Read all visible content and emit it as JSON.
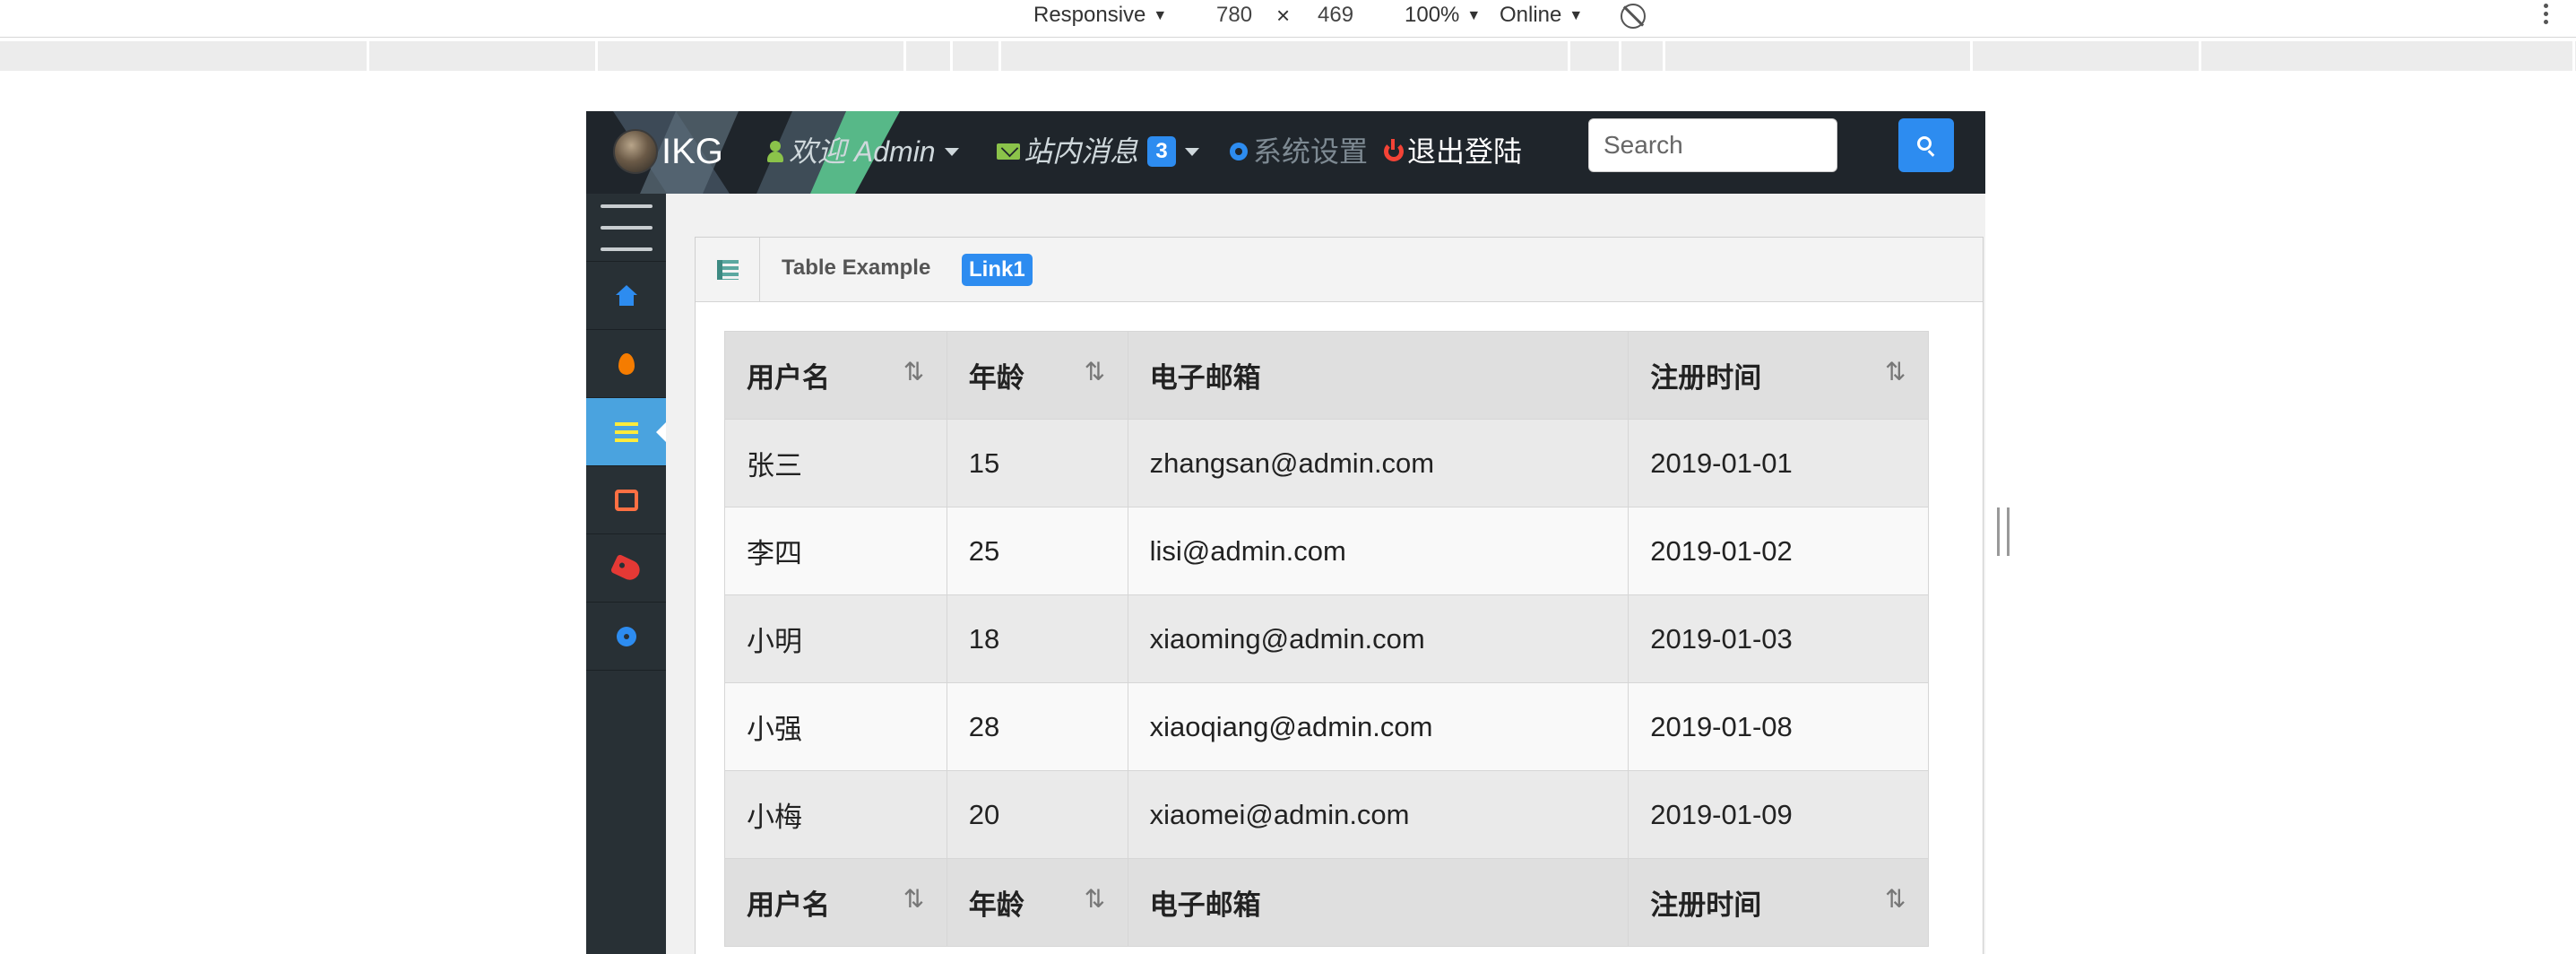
{
  "devtools": {
    "device": "Responsive",
    "width": "780",
    "times": "×",
    "height": "469",
    "zoom": "100%",
    "network": "Online"
  },
  "app": {
    "brand": "IKG",
    "nav": {
      "welcome": "欢迎 Admin",
      "messages": "站内消息",
      "message_count": "3",
      "settings": "系统设置",
      "logout": "退出登陆"
    },
    "search": {
      "placeholder": "Search"
    },
    "sidebar": {
      "items": [
        {
          "icon": "menu-icon"
        },
        {
          "icon": "home-icon"
        },
        {
          "icon": "fire-icon"
        },
        {
          "icon": "list-icon",
          "active": true
        },
        {
          "icon": "inbox-icon"
        },
        {
          "icon": "tag-icon"
        },
        {
          "icon": "gear-icon"
        }
      ]
    },
    "panel": {
      "title": "Table Example",
      "badge": "Link1"
    },
    "table": {
      "headers": [
        "用户名",
        "年龄",
        "电子邮箱",
        "注册时间"
      ],
      "sort_glyph": "⇅",
      "rows": [
        [
          "张三",
          "15",
          "zhangsan@admin.com",
          "2019-01-01"
        ],
        [
          "李四",
          "25",
          "lisi@admin.com",
          "2019-01-02"
        ],
        [
          "小明",
          "18",
          "xiaoming@admin.com",
          "2019-01-03"
        ],
        [
          "小强",
          "28",
          "xiaoqiang@admin.com",
          "2019-01-08"
        ],
        [
          "小梅",
          "20",
          "xiaomei@admin.com",
          "2019-01-09"
        ]
      ]
    }
  },
  "colors": {
    "navbar": "#1f252b",
    "sidebar": "#283035",
    "accent": "#2d8cf0",
    "sidebar_active": "#4aa3df"
  }
}
